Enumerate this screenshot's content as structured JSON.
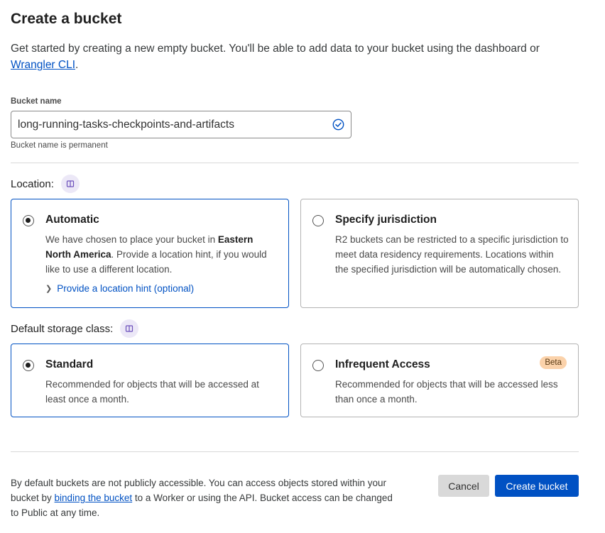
{
  "page": {
    "title": "Create a bucket",
    "intro": "Get started by creating a new empty bucket. You'll be able to add data to your bucket using the dashboard or",
    "intro_link": "Wrangler CLI",
    "intro_end": "."
  },
  "bucket_name": {
    "label": "Bucket name",
    "value": "long-running-tasks-checkpoints-and-artifacts",
    "help": "Bucket name is permanent"
  },
  "location": {
    "label": "Location:",
    "options": [
      {
        "title": "Automatic",
        "desc_1": "We have chosen to place your bucket in ",
        "desc_bold": "Eastern North America",
        "desc_2": ". Provide a location hint, if you would like to use a different location.",
        "hint_link": "Provide a location hint (optional)",
        "selected": true
      },
      {
        "title": "Specify jurisdiction",
        "desc": "R2 buckets can be restricted to a specific jurisdiction to meet data residency requirements. Locations within the specified jurisdiction will be automatically chosen.",
        "selected": false
      }
    ]
  },
  "storage_class": {
    "label": "Default storage class:",
    "options": [
      {
        "title": "Standard",
        "desc": "Recommended for objects that will be accessed at least once a month.",
        "selected": true
      },
      {
        "title": "Infrequent Access",
        "badge": "Beta",
        "desc": "Recommended for objects that will be accessed less than once a month.",
        "selected": false
      }
    ]
  },
  "footer": {
    "text_1": "By default buckets are not publicly accessible. You can access objects stored within your bucket by ",
    "link": "binding the bucket",
    "text_2": " to a Worker or using the API. Bucket access can be changed to Public at any time.",
    "cancel_label": "Cancel",
    "create_label": "Create bucket"
  },
  "colors": {
    "accent": "#0051c3",
    "badge_bg": "#fbd2aa",
    "info_badge_bg": "#ece8f7"
  },
  "icons": {
    "valid": "check-circle-icon",
    "docs": "book-icon",
    "expand": "chevron-right-icon"
  }
}
